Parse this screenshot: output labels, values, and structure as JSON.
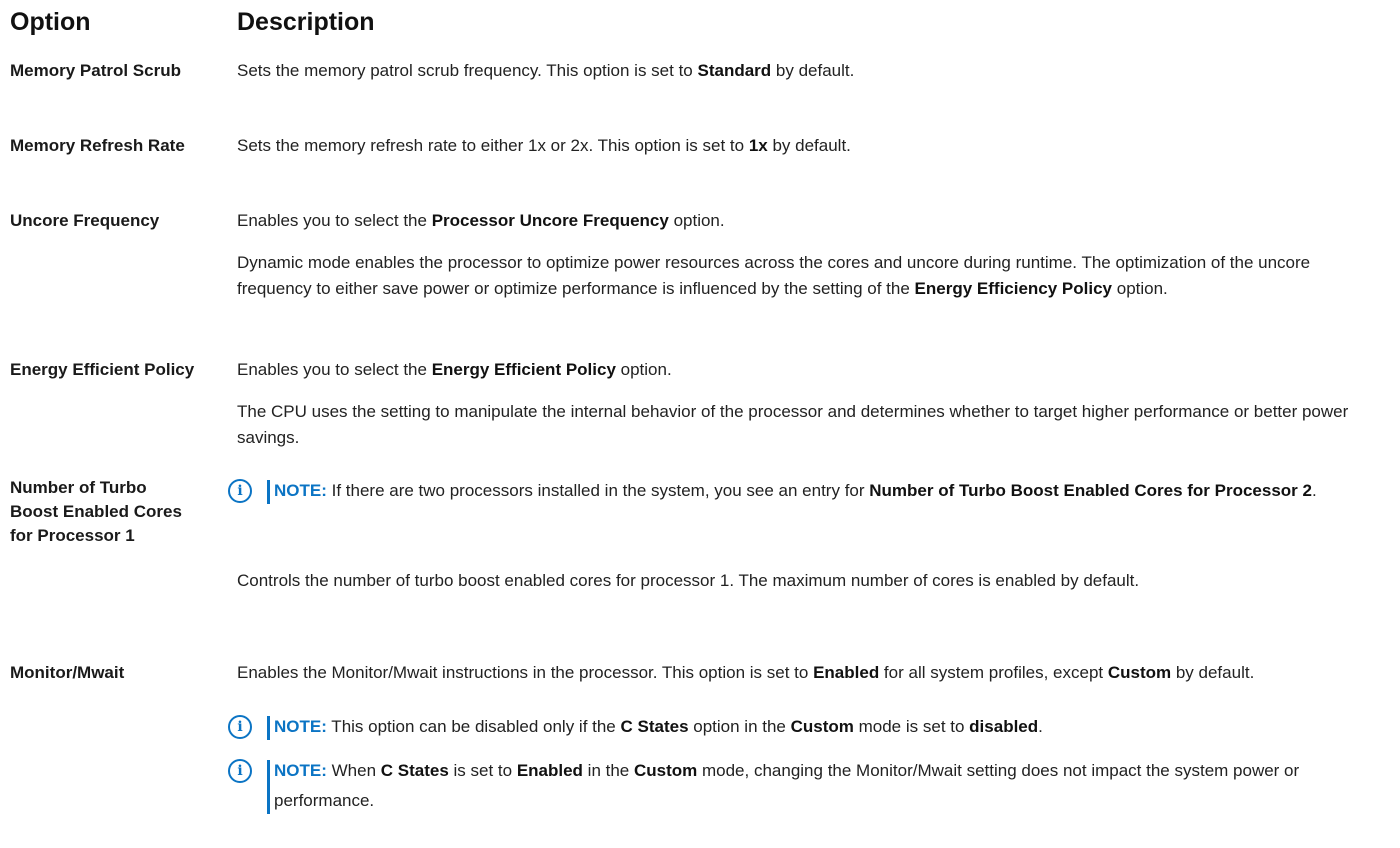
{
  "header": {
    "option": "Option",
    "description": "Description"
  },
  "rows": {
    "patrol": {
      "option": "Memory Patrol Scrub",
      "d1": "Sets the memory patrol scrub frequency. This option is set to ",
      "b1": "Standard",
      "d2": " by default."
    },
    "refresh": {
      "option": "Memory Refresh Rate",
      "d1": "Sets the memory refresh rate to either 1x or 2x. This option is set to ",
      "b1": "1x",
      "d2": " by default."
    },
    "uncore": {
      "option": "Uncore Frequency",
      "p1a": "Enables you to select the ",
      "p1b": "Processor Uncore Frequency",
      "p1c": " option.",
      "p2a": "Dynamic mode enables the processor to optimize power resources across the cores and uncore during runtime. The optimization of the uncore frequency to either save power or optimize performance is influenced by the setting of the ",
      "p2b": "Energy Efficiency Policy",
      "p2c": " option."
    },
    "eep": {
      "option": "Energy Efficient Policy",
      "p1a": "Enables you to select the ",
      "p1b": "Energy Efficient Policy",
      "p1c": " option.",
      "p2": "The CPU uses the setting to manipulate the internal behavior of the processor and determines whether to target higher performance or better power savings."
    },
    "turbo": {
      "option": "Number of Turbo Boost Enabled Cores for Processor 1",
      "note_label": "NOTE:",
      "note_a": " If there are two processors installed in the system, you see an entry for ",
      "note_b": "Number of Turbo Boost Enabled Cores for Processor 2",
      "note_c": ".",
      "p1": "Controls the number of turbo boost enabled cores for processor 1. The maximum number of cores is enabled by default."
    },
    "mwait": {
      "option": "Monitor/Mwait",
      "p1a": "Enables the Monitor/Mwait instructions in the processor. This option is set to ",
      "p1b": "Enabled",
      "p1c": " for all system profiles, except ",
      "p1d": "Custom",
      "p1e": " by default.",
      "note1_label": "NOTE:",
      "note1_a": " This option can be disabled only if the ",
      "note1_b": "C States",
      "note1_c": " option in the ",
      "note1_d": "Custom",
      "note1_e": " mode is set to ",
      "note1_f": "disabled",
      "note1_g": ".",
      "note2_label": "NOTE:",
      "note2_a": " When ",
      "note2_b": "C States",
      "note2_c": " is set to ",
      "note2_d": "Enabled",
      "note2_e": " in the ",
      "note2_f": "Custom",
      "note2_g": " mode, changing the Monitor/Mwait setting does not impact the system power or performance."
    }
  },
  "icons": {
    "note": "info-icon",
    "accent": "#0b74c4"
  }
}
